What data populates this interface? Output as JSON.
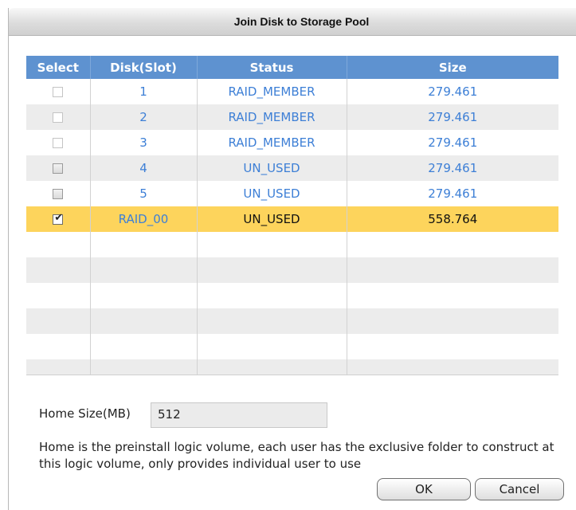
{
  "dialog": {
    "title": "Join Disk to Storage Pool"
  },
  "table": {
    "columns": [
      "Select",
      "Disk(Slot)",
      "Status",
      "Size"
    ],
    "rows": [
      {
        "checkbox": "disabled",
        "disk": "1",
        "status": "RAID_MEMBER",
        "size": "279.461"
      },
      {
        "checkbox": "disabled",
        "disk": "2",
        "status": "RAID_MEMBER",
        "size": "279.461"
      },
      {
        "checkbox": "disabled",
        "disk": "3",
        "status": "RAID_MEMBER",
        "size": "279.461"
      },
      {
        "checkbox": "unchecked",
        "disk": "4",
        "status": "UN_USED",
        "size": "279.461"
      },
      {
        "checkbox": "unchecked",
        "disk": "5",
        "status": "UN_USED",
        "size": "279.461"
      },
      {
        "checkbox": "checked",
        "disk": "RAID_00",
        "status": "UN_USED",
        "size": "558.764"
      }
    ],
    "selected_row_color": "#fdd45c",
    "header_color": "#5e92d0",
    "link_text_color": "#3d7fd6"
  },
  "home": {
    "label": "Home Size(MB)",
    "value": "512",
    "description": "Home is the preinstall logic volume, each user has the exclusive folder to construct at this logic volume, only provides individual user to use"
  },
  "buttons": {
    "ok": "OK",
    "cancel": "Cancel"
  }
}
